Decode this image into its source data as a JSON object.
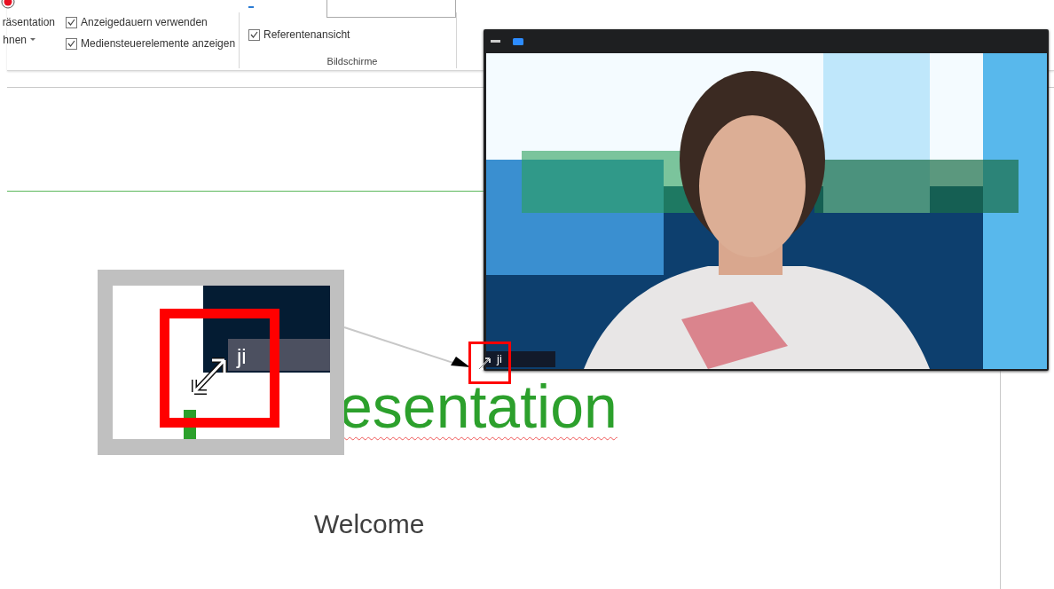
{
  "ribbon": {
    "record_button": {
      "label_lines": [
        "räsentation",
        "hnen"
      ]
    },
    "checkboxes": [
      {
        "label": "Anzeigedauern verwenden",
        "checked": true
      },
      {
        "label": "Mediensteuerelemente anzeigen",
        "checked": true
      }
    ],
    "screens_group": {
      "checkboxes": [
        {
          "label": "Referentenansicht",
          "checked": true
        }
      ],
      "label": "Bildschirme"
    }
  },
  "slide": {
    "title": "esentation",
    "subtitle": "Welcome"
  },
  "video_window": {
    "name_tag": "ji"
  },
  "magnifier": {
    "name_tag": "ji"
  }
}
